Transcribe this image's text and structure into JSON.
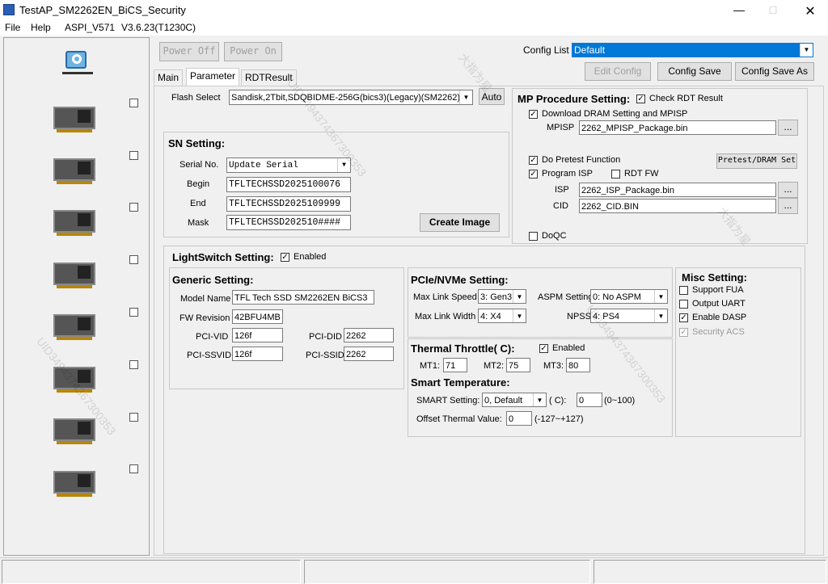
{
  "window": {
    "title": "TestAP_SM2262EN_BiCS_Security",
    "icon": "app-cube-icon"
  },
  "menu": [
    "File",
    "Help",
    "ASPI_V571",
    "V3.6.23(T1230C)"
  ],
  "top_buttons": {
    "power_off": "Power Off",
    "power_on": "Power On"
  },
  "config": {
    "label": "Config List",
    "value": "Default",
    "edit": "Edit Config",
    "save": "Config Save",
    "save_as": "Config Save As"
  },
  "tabs": [
    "Main",
    "Parameter",
    "RDTResult"
  ],
  "flash": {
    "label": "Flash Select",
    "value": "Sandisk,2Tbit,SDQBIDME-256G(bics3)(Legacy)(SM2262)",
    "auto": "Auto"
  },
  "sn": {
    "title": "SN Setting:",
    "serial_label": "Serial No.",
    "serial_value": "Update Serial",
    "begin_label": "Begin",
    "begin": "TFLTECHSSD2025100076",
    "end_label": "End",
    "end": "TFLTECHSSD2025109999",
    "mask_label": "Mask",
    "mask": "TFLTECHSSD202510####",
    "create": "Create Image"
  },
  "mp": {
    "title": "MP Procedure Setting:",
    "check_rdt": "Check RDT Result",
    "download_dram": "Download DRAM Setting and MPISP",
    "mpisp_label": "MPISP",
    "mpisp": "2262_MPISP_Package.bin",
    "browse": "...",
    "pretest": "Do Pretest Function",
    "pretest_btn": "Pretest/DRAM Set",
    "program_isp": "Program ISP",
    "rdt_fw": "RDT FW",
    "isp_label": "ISP",
    "isp": "2262_ISP_Package.bin",
    "cid_label": "CID",
    "cid": "2262_CID.BIN",
    "doqc": "DoQC"
  },
  "lightswitch": {
    "title": "LightSwitch Setting:",
    "enabled": "Enabled"
  },
  "generic": {
    "title": "Generic Setting:",
    "model_label": "Model Name",
    "model": "TFL Tech SSD SM2262EN BiCS3",
    "fw_label": "FW Revision",
    "fw": "42BFU4MB",
    "vid_label": "PCI-VID",
    "vid": "126f",
    "did_label": "PCI-DID",
    "did": "2262",
    "ssvid_label": "PCI-SSVID",
    "ssvid": "126f",
    "ssid_label": "PCI-SSID",
    "ssid": "2262"
  },
  "pcie": {
    "title": "PCIe/NVMe Setting:",
    "speed_label": "Max Link Speed",
    "speed": "3: Gen3",
    "width_label": "Max Link Width",
    "width": "4: X4",
    "aspm_label": "ASPM Setting",
    "aspm": "0: No ASPM",
    "npss_label": "NPSS",
    "npss": "4: PS4"
  },
  "thermal": {
    "title": "Thermal Throttle(     C):",
    "enabled": "Enabled",
    "mt1_label": "MT1:",
    "mt1": "71",
    "mt2_label": "MT2:",
    "mt2": "75",
    "mt3_label": "MT3:",
    "mt3": "80",
    "smart_title": "Smart Temperature:",
    "smart_label": "SMART Setting:",
    "smart": "0, Default",
    "c_label": "(    C):",
    "c_value": "0",
    "c_range": "(0~100)",
    "offset_label": "Offset Thermal Value:",
    "offset": "0",
    "offset_range": "(-127~+127)"
  },
  "misc": {
    "title": "Misc Setting:",
    "fua": "Support FUA",
    "uart": "Output UART",
    "dasp": "Enable DASP",
    "acs": "Security ACS"
  },
  "watermark": [
    "大指为星",
    "UID3494374367300353"
  ]
}
